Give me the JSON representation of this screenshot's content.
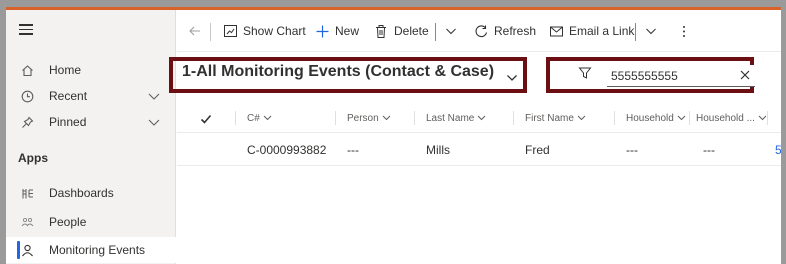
{
  "sidebar": {
    "menu_icon": "hamburger-icon",
    "items": [
      {
        "label": "Home",
        "icon": "home-icon"
      },
      {
        "label": "Recent",
        "icon": "clock-icon"
      },
      {
        "label": "Pinned",
        "icon": "pin-icon"
      }
    ],
    "apps_heading": "Apps",
    "apps": [
      {
        "label": "Dashboards",
        "icon": "dashboard-icon"
      },
      {
        "label": "People",
        "icon": "people-icon"
      },
      {
        "label": "Monitoring Events",
        "icon": "person-icon",
        "selected": true
      }
    ]
  },
  "commandbar": {
    "back_icon": "back-arrow-icon",
    "show_chart": "Show Chart",
    "new": "New",
    "delete": "Delete",
    "refresh": "Refresh",
    "email_link": "Email a Link",
    "more_icon": "more-vertical-icon"
  },
  "view": {
    "title": "1-All Monitoring Events (Contact & Case)"
  },
  "search": {
    "value": "5555555555"
  },
  "grid": {
    "columns": [
      "C#",
      "Person",
      "Last Name",
      "First Name",
      "Household",
      "Household ..."
    ],
    "rows": [
      {
        "c_number": "C-0000993882",
        "person": "---",
        "last_name": "Mills",
        "first_name": "Fred",
        "household": "---",
        "household2": "---",
        "extra": "5"
      }
    ]
  },
  "colors": {
    "accent": "#2266e3",
    "highlight_box": "#6b0f12",
    "top_bar": "#d9622b"
  }
}
